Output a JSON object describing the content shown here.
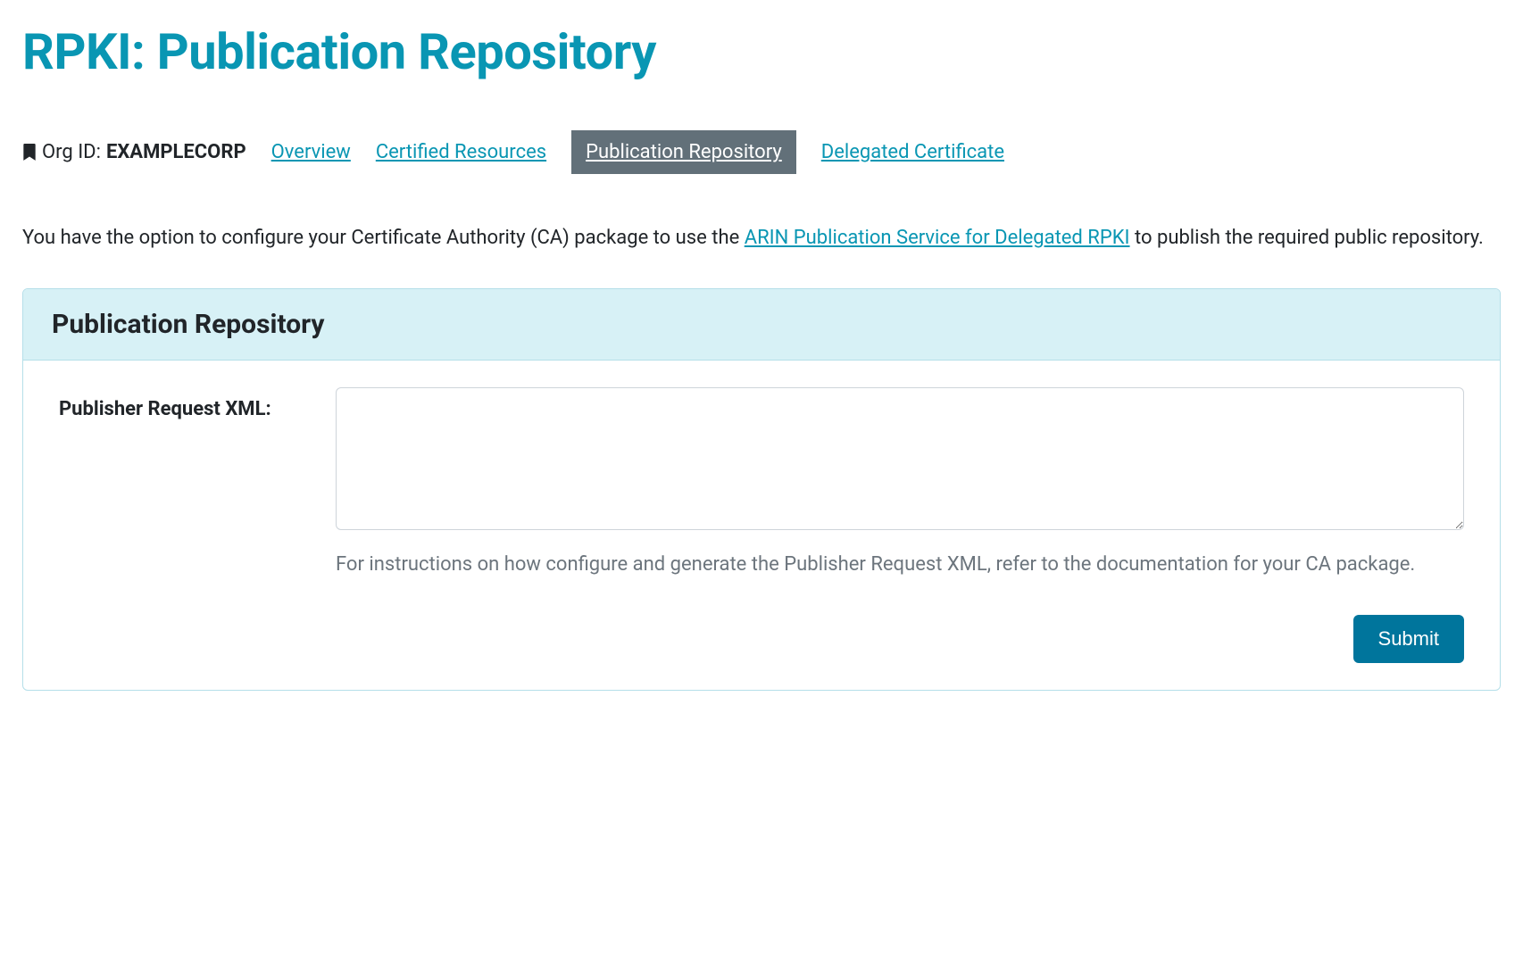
{
  "page": {
    "title": "RPKI: Publication Repository"
  },
  "orgid": {
    "label": "Org ID:",
    "value": "EXAMPLECORP"
  },
  "tabs": {
    "overview": "Overview",
    "certified_resources": "Certified Resources",
    "publication_repository": "Publication Repository",
    "delegated_certificate": "Delegated Certificate"
  },
  "intro": {
    "prefix": "You have the option to configure your Certificate Authority (CA) package to use the ",
    "link_text": "ARIN Publication Service for Delegated RPKI",
    "suffix": " to publish the required public repository."
  },
  "card": {
    "header": "Publication Repository",
    "form": {
      "label": "Publisher Request XML:",
      "textarea_value": "",
      "help_text": "For instructions on how configure and generate the Publisher Request XML, refer to the documentation for your CA package.",
      "submit_label": "Submit"
    }
  }
}
